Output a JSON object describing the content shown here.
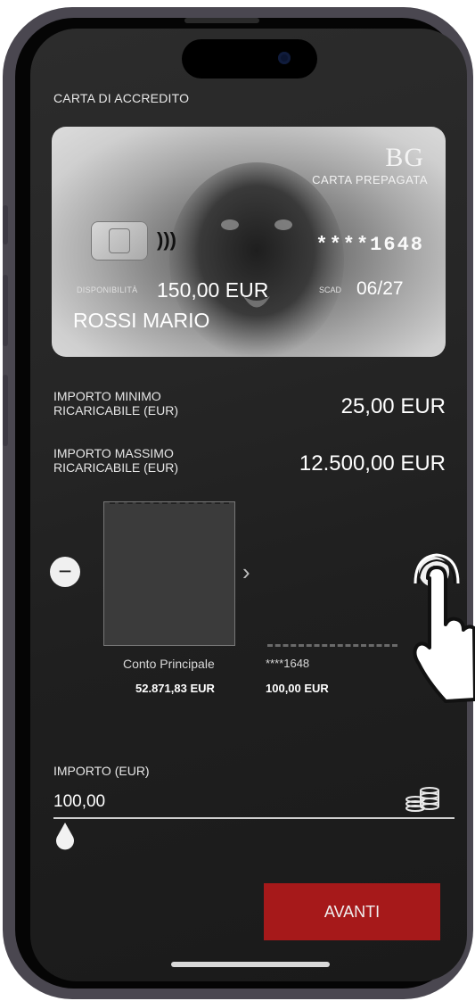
{
  "section_title": "CARTA DI ACCREDITO",
  "card": {
    "bank_logo": "BG",
    "card_type": "CARTA PREPAGATA",
    "masked_number": "****1648",
    "available_label": "DISPONIBILITÀ",
    "available_value": "150,00 EUR",
    "expiry_label": "SCAD",
    "expiry_value": "06/27",
    "holder": "ROSSI MARIO"
  },
  "limits": {
    "min_label": "IMPORTO MINIMO RICARICABILE (EUR)",
    "min_value": "25,00 EUR",
    "max_label": "IMPORTO MASSIMO RICARICABILE (EUR)",
    "max_value": "12.500,00 EUR"
  },
  "source_account": {
    "name": "Conto Principale",
    "balance": "52.871,83",
    "currency": "EUR"
  },
  "target_card": {
    "name": "****1648",
    "balance": "100,00 EUR"
  },
  "controls": {
    "minus": "−",
    "plus": "+",
    "next": "›"
  },
  "amount": {
    "label": "IMPORTO (EUR)",
    "value": "100,00"
  },
  "actions": {
    "next_label": "AVANTI"
  },
  "icons": {
    "coins": "coins-icon",
    "drop": "drop-icon",
    "contactless": "contactless-icon",
    "hand": "tap-hand-icon"
  },
  "colors": {
    "accent": "#a6191a",
    "screen_bg": "#262626"
  }
}
